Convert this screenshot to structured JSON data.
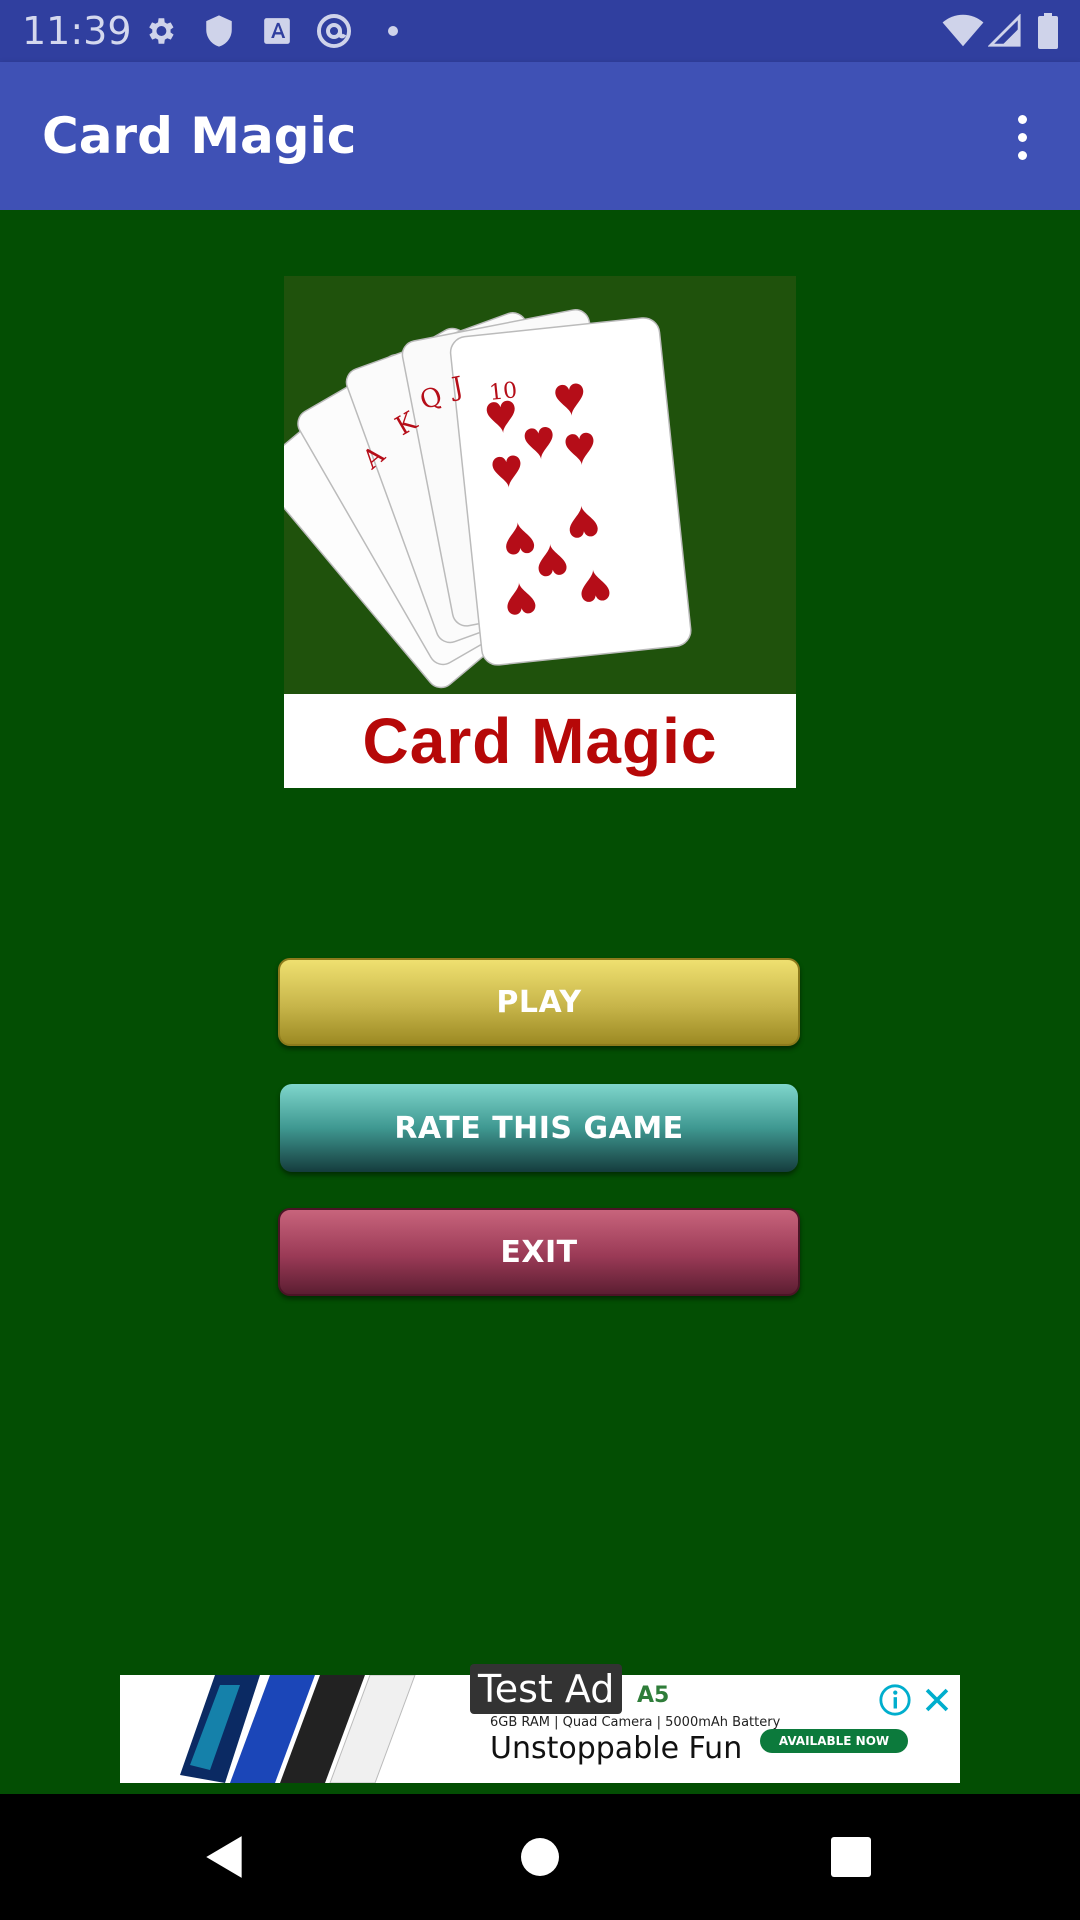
{
  "status_bar": {
    "time": "11:39",
    "icons": [
      "gear-icon",
      "shield-icon",
      "font-a-icon",
      "at-sign-icon",
      "dot-icon",
      "wifi-icon",
      "signal-icon",
      "battery-icon"
    ]
  },
  "app_bar": {
    "title": "Card Magic",
    "overflow_icon": "more-vert-icon"
  },
  "logo": {
    "caption": "Card Magic",
    "card_ranks": [
      "A",
      "K",
      "Q",
      "J",
      "10"
    ]
  },
  "buttons": {
    "play": "PLAY",
    "rate": "RATE THIS GAME",
    "exit": "EXIT"
  },
  "ad": {
    "tag": "Test Ad",
    "brand": "A5",
    "specs": "6GB RAM | Quad Camera | 5000mAh Battery",
    "headline": "Unstoppable Fun",
    "cta": "AVAILABLE NOW"
  },
  "nav_bar": {
    "icons": [
      "back-icon",
      "home-icon",
      "recents-icon"
    ]
  },
  "colors": {
    "status_bar": "#303f9f",
    "app_bar": "#3f51b5",
    "background": "#034e03",
    "logo_text": "#b60808"
  }
}
